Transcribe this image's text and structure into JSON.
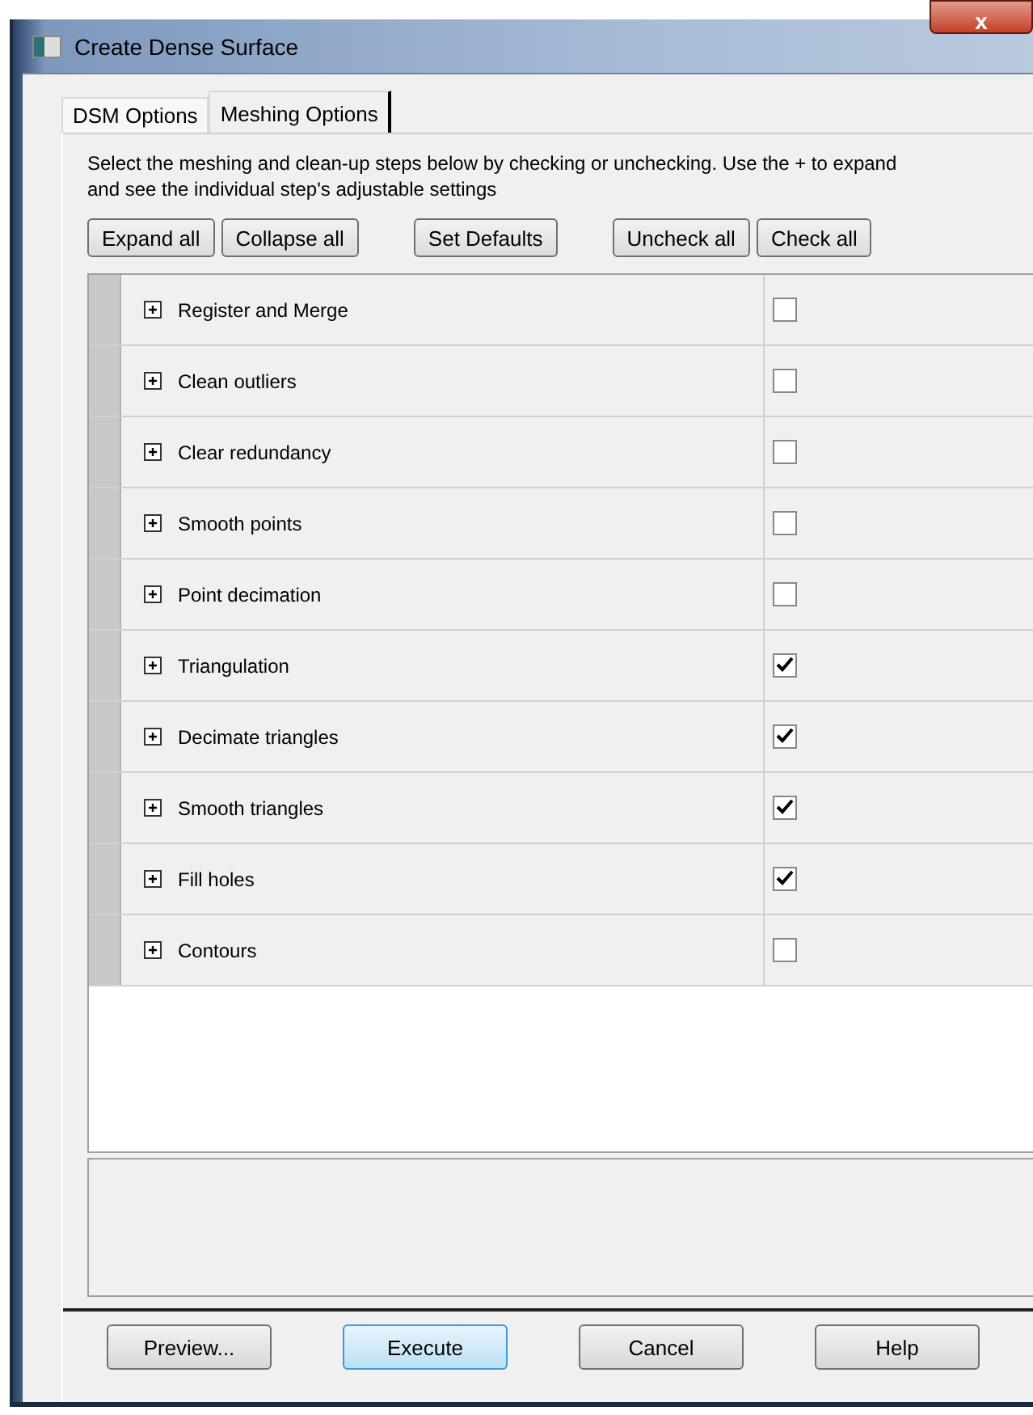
{
  "window": {
    "title": "Create Dense Surface",
    "close": "x"
  },
  "tabs": [
    {
      "label": "DSM Options",
      "selected": false
    },
    {
      "label": "Meshing Options",
      "selected": true
    }
  ],
  "description": "Select the meshing and clean-up steps below by checking or unchecking. Use the + to expand and see the individual step's adjustable settings",
  "toolbar": [
    [
      "Expand all",
      "Collapse all"
    ],
    [
      "Set Defaults"
    ],
    [
      "Uncheck all",
      "Check all"
    ]
  ],
  "steps": [
    {
      "label": "Register and Merge",
      "expanded": false,
      "checked": false
    },
    {
      "label": "Clean outliers",
      "expanded": false,
      "checked": false
    },
    {
      "label": "Clear redundancy",
      "expanded": false,
      "checked": false
    },
    {
      "label": "Smooth points",
      "expanded": false,
      "checked": false
    },
    {
      "label": "Point decimation",
      "expanded": false,
      "checked": false
    },
    {
      "label": "Triangulation",
      "expanded": false,
      "checked": true
    },
    {
      "label": "Decimate triangles",
      "expanded": false,
      "checked": true
    },
    {
      "label": "Smooth triangles",
      "expanded": false,
      "checked": true
    },
    {
      "label": "Fill holes",
      "expanded": false,
      "checked": true
    },
    {
      "label": "Contours",
      "expanded": false,
      "checked": false
    }
  ],
  "buttons": [
    {
      "label": "Preview...",
      "default": false
    },
    {
      "label": "Execute",
      "default": true
    },
    {
      "label": "Cancel",
      "default": false
    },
    {
      "label": "Help",
      "default": false
    }
  ]
}
